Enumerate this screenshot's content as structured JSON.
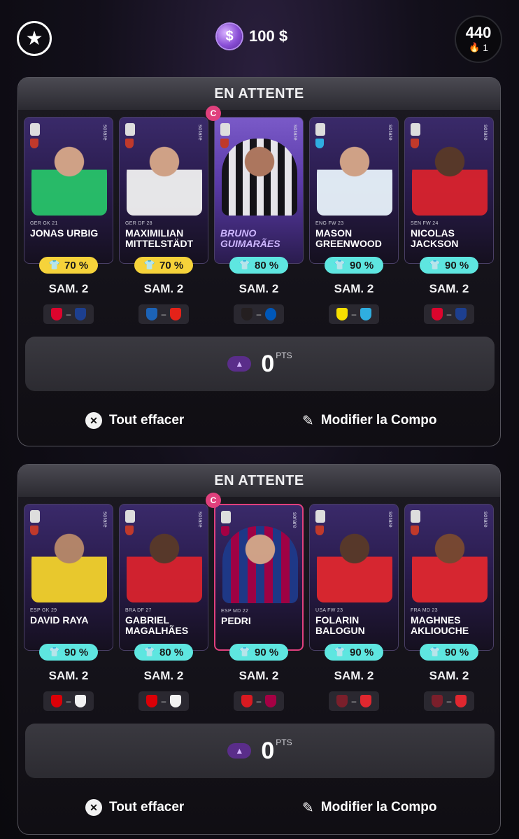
{
  "header": {
    "coin_symbol": "$",
    "balance": "100 $",
    "score": "440",
    "streak": "1"
  },
  "lineups": [
    {
      "status": "EN ATTENTE",
      "captain_badge": "C",
      "cards": [
        {
          "name": "JONAS URBIG",
          "meta": "GER  GK  21",
          "bonus": "70 %",
          "pill": "yellow",
          "match": "SAM. 2",
          "kit": "#28c36a"
        },
        {
          "name": "MAXIMILIAN MITTELSTÄDT",
          "meta": "GER  DF  28",
          "bonus": "70 %",
          "pill": "yellow",
          "match": "SAM. 2",
          "kit": "#f1f1f1"
        },
        {
          "name": "BRUNO GUIMARÃES",
          "meta": "",
          "bonus": "80 %",
          "pill": "cyan",
          "match": "SAM. 2",
          "kit": "#eaeaea"
        },
        {
          "name": "MASON GREENWOOD",
          "meta": "ENG  FW  23",
          "bonus": "90 %",
          "pill": "cyan",
          "match": "SAM. 2",
          "kit": "#e8f3fb"
        },
        {
          "name": "NICOLAS JACKSON",
          "meta": "SEN  FW  24",
          "bonus": "90 %",
          "pill": "cyan",
          "match": "SAM. 2",
          "kit": "#d9232e"
        }
      ],
      "points": "0",
      "pts_label": "PTS",
      "clear_label": "Tout effacer",
      "edit_label": "Modifier la Compo"
    },
    {
      "status": "EN ATTENTE",
      "captain_badge": "C",
      "cards": [
        {
          "name": "DAVID RAYA",
          "meta": "ESP  GK  29",
          "bonus": "90 %",
          "pill": "cyan",
          "match": "SAM. 2",
          "kit": "#f3d22c"
        },
        {
          "name": "GABRIEL MAGALHÃES",
          "meta": "BRA  DF  27",
          "bonus": "80 %",
          "pill": "cyan",
          "match": "SAM. 2",
          "kit": "#d9232e"
        },
        {
          "name": "PEDRI",
          "meta": "ESP  MD  22",
          "bonus": "90 %",
          "pill": "cyan",
          "match": "SAM. 2",
          "kit": "#1e3a8a"
        },
        {
          "name": "FOLARIN BALOGUN",
          "meta": "USA  FW  23",
          "bonus": "90 %",
          "pill": "cyan",
          "match": "SAM. 2",
          "kit": "#e0272f"
        },
        {
          "name": "MAGHNES AKLIOUCHE",
          "meta": "FRA  MD  23",
          "bonus": "90 %",
          "pill": "cyan",
          "match": "SAM. 2",
          "kit": "#e0272f"
        }
      ],
      "points": "0",
      "pts_label": "PTS",
      "clear_label": "Tout effacer",
      "edit_label": "Modifier la Compo"
    }
  ]
}
